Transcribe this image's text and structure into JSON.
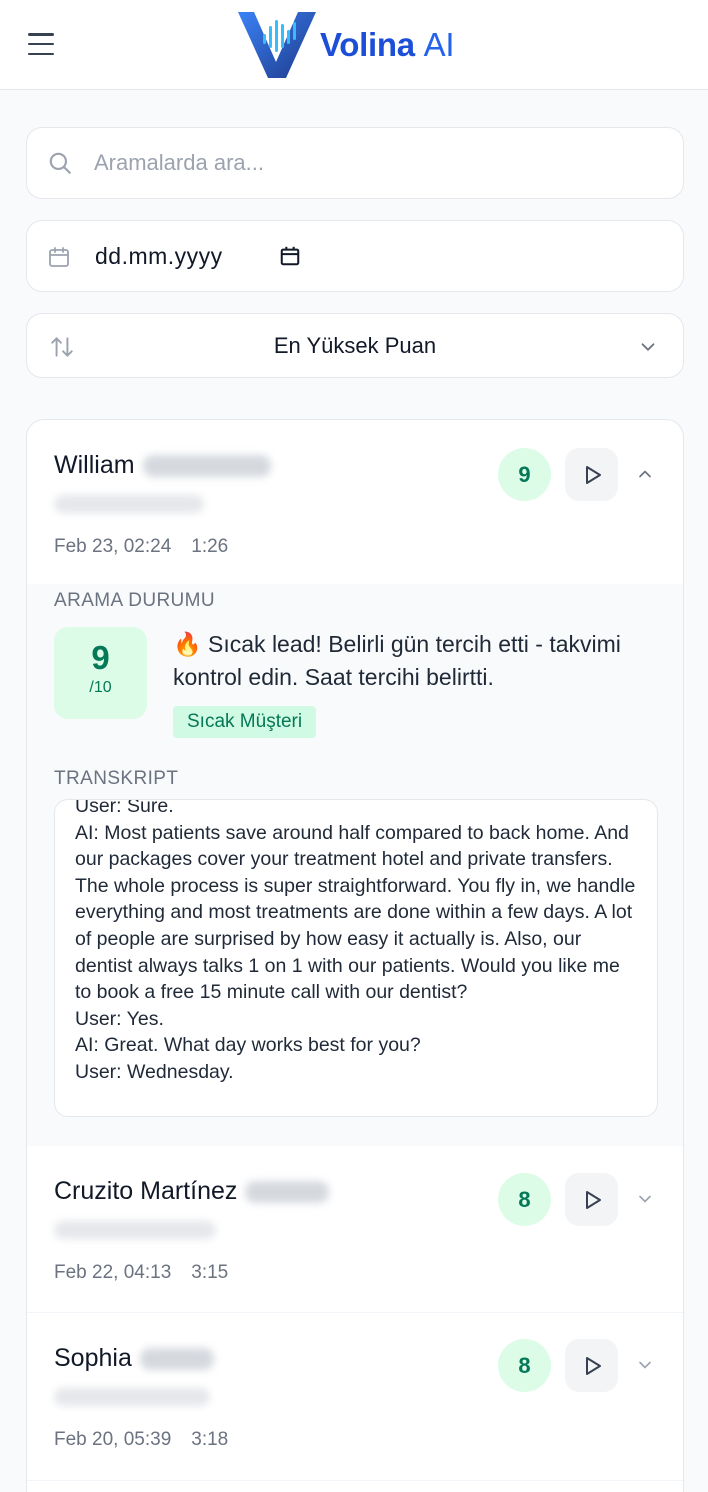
{
  "app": {
    "brand": "Volina",
    "brand_suffix": "AI"
  },
  "search": {
    "placeholder": "Aramalarda ara..."
  },
  "date_filter": {
    "value": "dd.mm.yyyy"
  },
  "sort": {
    "label": "En Yüksek Puan"
  },
  "colors": {
    "accent": "#2563eb",
    "score_bg": "#dcfce7",
    "score_fg": "#047857"
  },
  "calls": [
    {
      "first_name": "William",
      "date": "Feb 23, 02:24",
      "duration": "1:26",
      "score": "9",
      "expanded": true
    },
    {
      "first_name": "Cruzito Martínez",
      "date": "Feb 22, 04:13",
      "duration": "3:15",
      "score": "8",
      "expanded": false
    },
    {
      "first_name": "Sophia",
      "date": "Feb 20, 05:39",
      "duration": "3:18",
      "score": "8",
      "expanded": false
    }
  ],
  "detail": {
    "status_title": "ARAMA DURUMU",
    "score": "9",
    "score_max": "/10",
    "status_message": "🔥 Sıcak lead! Belirli gün tercih etti - takvimi kontrol edin. Saat tercihi belirtti.",
    "tag": "Sıcak Müşteri",
    "transcript_title": "TRANSKRIPT",
    "transcript": [
      "User: Sure.",
      "AI: Most patients save around half compared to back home. And our packages cover your treatment hotel and private transfers. The whole process is super straightforward. You fly in, we handle everything and most treatments are done within a few days. A lot of people are surprised by how easy it actually is. Also, our dentist always talks 1 on 1 with our patients. Would you like me to book a free 15 minute call with our dentist?",
      "User: Yes.",
      "AI: Great. What day works best for you?",
      "User: Wednesday."
    ]
  }
}
